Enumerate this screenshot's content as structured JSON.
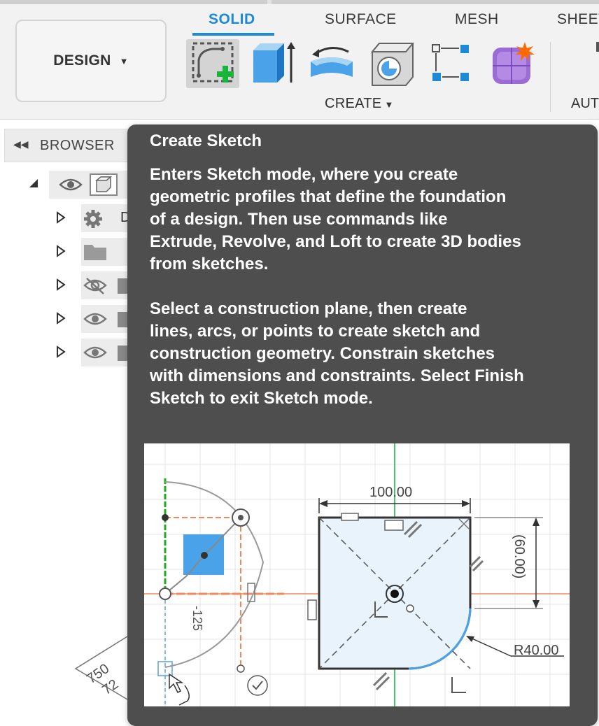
{
  "toolbar": {
    "workspace_label": "DESIGN",
    "tabs": [
      {
        "label": "SOLID",
        "active": true
      },
      {
        "label": "SURFACE",
        "active": false
      },
      {
        "label": "MESH",
        "active": false
      },
      {
        "label": "SHEET",
        "active": false
      }
    ],
    "create_label": "CREATE",
    "next_group_label": "AUT",
    "tools": [
      {
        "icon": "create-sketch-icon",
        "selected": true
      },
      {
        "icon": "extrude-icon"
      },
      {
        "icon": "revolve-icon"
      },
      {
        "icon": "hole-icon"
      },
      {
        "icon": "pattern-icon"
      },
      {
        "icon": "form-icon"
      }
    ],
    "accent_color": "#1e8ad6"
  },
  "browser": {
    "title": "BROWSER",
    "rows": [
      {
        "icons": [
          "eye-icon",
          "component-icon"
        ],
        "text": ""
      },
      {
        "icons": [
          "gear-icon"
        ],
        "text": "D"
      },
      {
        "icons": [
          "folder-icon"
        ],
        "text": ""
      },
      {
        "icons": [
          "eye-hidden-icon",
          "folder-icon"
        ],
        "text": ""
      },
      {
        "icons": [
          "eye-icon",
          "folder-icon"
        ],
        "text": ""
      },
      {
        "icons": [
          "eye-icon",
          "folder-icon"
        ],
        "text": ""
      }
    ]
  },
  "canvas": {
    "visible_dimensions": [
      "750",
      "72"
    ]
  },
  "tooltip": {
    "title": "Create Sketch",
    "paragraph1_lines": [
      "Enters Sketch mode, where you create",
      "geometric profiles that define the foundation",
      "of a design. Then use commands like",
      "Extrude, Revolve, and Loft to create 3D bodies",
      "from sketches."
    ],
    "paragraph2_lines": [
      "Select a construction plane, then create",
      "lines, arcs, or points to create sketch and",
      "construction geometry. Constrain sketches",
      "with dimensions and constraints. Select Finish",
      "Sketch to exit Sketch mode."
    ],
    "illustration": {
      "dimension_width": "100.00",
      "dimension_height": "(60.00)",
      "dimension_radius": "R40.00",
      "dimension_offset": "-125"
    },
    "background_color": "#4e4e4e"
  }
}
